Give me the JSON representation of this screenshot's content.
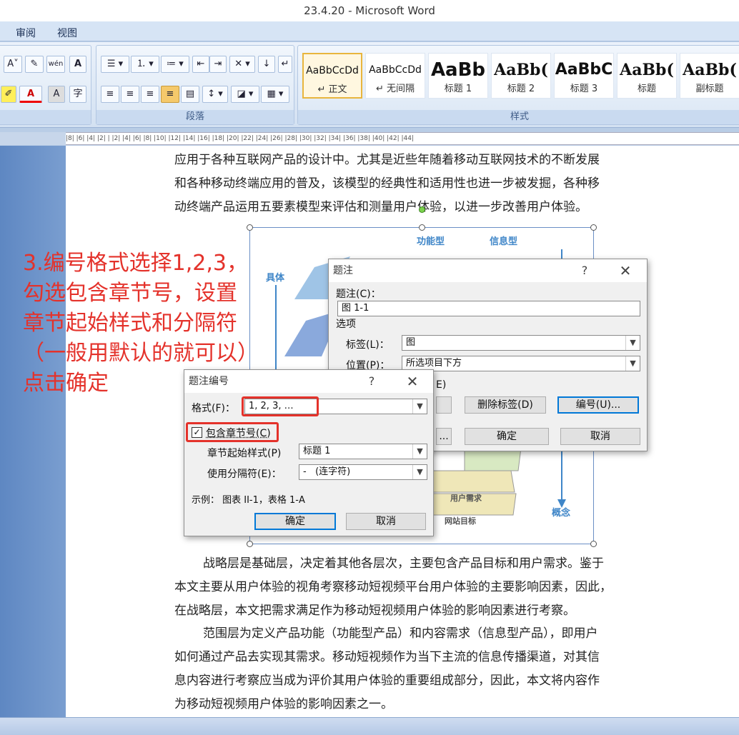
{
  "window": {
    "title": "23.4.20 - Microsoft Word"
  },
  "menu_tabs": [
    "审阅",
    "视图"
  ],
  "ribbon": {
    "font_group": {
      "buttons": [
        "A˅",
        "wén",
        "A",
        "A",
        "A",
        "字"
      ]
    },
    "paragraph_group": {
      "label": "段落"
    },
    "styles_group": {
      "label": "样式",
      "styles": [
        {
          "sample": "AaBbCcDd",
          "name": "↵ 正文",
          "selected": true
        },
        {
          "sample": "AaBbCcDd",
          "name": "↵ 无间隔",
          "selected": false
        },
        {
          "sample": "AaBb",
          "name": "标题 1",
          "selected": false
        },
        {
          "sample": "AaBb(",
          "name": "标题 2",
          "selected": false
        },
        {
          "sample": "AaBbC",
          "name": "标题 3",
          "selected": false
        },
        {
          "sample": "AaBb(",
          "name": "标题",
          "selected": false
        },
        {
          "sample": "AaBb(",
          "name": "副标题",
          "selected": false
        }
      ]
    }
  },
  "ruler": {
    "text": "|8| |6| |4| |2| | |2| |4| |6| |8| |10| |12| |14| |16| |18| |20| |22| |24| |26| |28| |30| |32| |34| |36| |38| |40| |42| |44|"
  },
  "document": {
    "para_top": [
      "应用于各种互联网产品的设计中。尤其是近些年随着移动互联网技术的不断发展",
      "和各种移动终端应用的普及，该模型的经典性和适用性也进一步被发掘，各种移",
      "动终端产品运用五要素模型来评估和测量用户体验，以进一步改善用户体验。"
    ],
    "para_strategy": [
      "战略层是基础层，决定着其他各层次，主要包含产品目标和用户需求。鉴于",
      "本文主要从用户体验的视角考察移动短视频平台用户体验的主要影响因素，因此，",
      "在战略层，本文把需求满足作为移动短视频用户体验的影响因素进行考察。"
    ],
    "para_scope": [
      "范围层为定义产品功能（功能型产品）和内容需求（信息型产品），即用户",
      "如何通过产品去实现其需求。移动短视频作为当下主流的信息传播渠道，对其信",
      "息内容进行考察应当成为评价其用户体验的重要组成部分，因此，本文将内容作",
      "为移动短视频用户体验的影响因素之一。"
    ]
  },
  "figure": {
    "label_functional": "功能型",
    "label_informational": "信息型",
    "label_concrete": "具体",
    "label_abstract": "概念",
    "layer_user_needs": "用户需求",
    "layer_site_goals": "网站目标"
  },
  "annotation": {
    "lines": [
      "3.编号格式选择1,2,3，",
      "勾选包含章节号，设置",
      "章节起始样式和分隔符",
      "（一般用默认的就可以）",
      "点击确定"
    ]
  },
  "caption_dialog": {
    "title": "题注",
    "help": "?",
    "close": "✕",
    "caption_label": "题注(C)：",
    "caption_value": "图 1-1",
    "options_label": "选项",
    "tag_label": "标签(L)：",
    "tag_value": "图",
    "position_label": "位置(P)：",
    "position_value": "所选项目下方",
    "exclude_partial": "E)",
    "delete_label_button": "删除标签(D)",
    "numbering_button": "编号(U)...",
    "partial_button": "...",
    "ok_button": "确定",
    "cancel_button": "取消"
  },
  "numbering_dialog": {
    "title": "题注编号",
    "help": "?",
    "close": "✕",
    "format_label": "格式(F)：",
    "format_value": "1, 2, 3, …",
    "include_chapter_label": "包含章节号(C)",
    "include_chapter_checked": true,
    "chapter_style_label": "章节起始样式(P)",
    "chapter_style_value": "标题 1",
    "separator_label": "使用分隔符(E)：",
    "separator_value": "-   (连字符)",
    "example": "示例： 图表 II-1，表格 1-A",
    "ok_button": "确定",
    "cancel_button": "取消"
  },
  "colors": {
    "annotation": "#e4322b",
    "dialog_default_border": "#0078d7",
    "ribbon": "#dbe7f5"
  }
}
